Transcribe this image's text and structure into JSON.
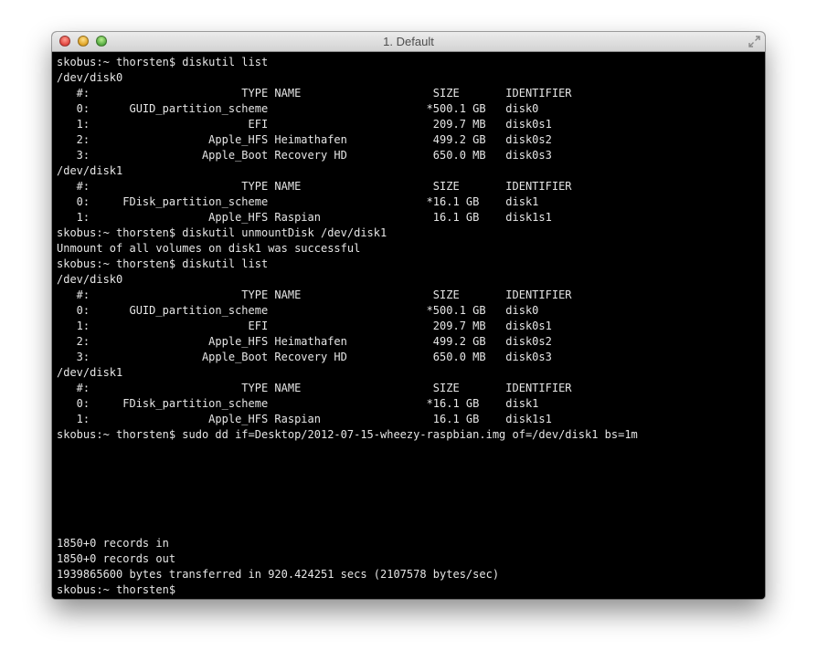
{
  "window": {
    "title": "1. Default"
  },
  "icons": {
    "close": "close-button",
    "minimize": "minimize-button",
    "zoom": "zoom-button",
    "fullscreen": "fullscreen-arrows-icon"
  },
  "terminal": {
    "lines": [
      "skobus:~ thorsten$ diskutil list",
      "/dev/disk0",
      "   #:                       TYPE NAME                    SIZE       IDENTIFIER",
      "   0:      GUID_partition_scheme                        *500.1 GB   disk0",
      "   1:                        EFI                         209.7 MB   disk0s1",
      "   2:                  Apple_HFS Heimathafen             499.2 GB   disk0s2",
      "   3:                 Apple_Boot Recovery HD             650.0 MB   disk0s3",
      "/dev/disk1",
      "   #:                       TYPE NAME                    SIZE       IDENTIFIER",
      "   0:     FDisk_partition_scheme                        *16.1 GB    disk1",
      "   1:                  Apple_HFS Raspian                 16.1 GB    disk1s1",
      "skobus:~ thorsten$ diskutil unmountDisk /dev/disk1",
      "Unmount of all volumes on disk1 was successful",
      "skobus:~ thorsten$ diskutil list",
      "/dev/disk0",
      "   #:                       TYPE NAME                    SIZE       IDENTIFIER",
      "   0:      GUID_partition_scheme                        *500.1 GB   disk0",
      "   1:                        EFI                         209.7 MB   disk0s1",
      "   2:                  Apple_HFS Heimathafen             499.2 GB   disk0s2",
      "   3:                 Apple_Boot Recovery HD             650.0 MB   disk0s3",
      "/dev/disk1",
      "   #:                       TYPE NAME                    SIZE       IDENTIFIER",
      "   0:     FDisk_partition_scheme                        *16.1 GB    disk1",
      "   1:                  Apple_HFS Raspian                 16.1 GB    disk1s1",
      "skobus:~ thorsten$ sudo dd if=Desktop/2012-07-15-wheezy-raspbian.img of=/dev/disk1 bs=1m",
      "",
      "",
      "",
      "",
      "",
      "",
      "1850+0 records in",
      "1850+0 records out",
      "1939865600 bytes transferred in 920.424251 secs (2107578 bytes/sec)",
      "skobus:~ thorsten$ "
    ]
  }
}
